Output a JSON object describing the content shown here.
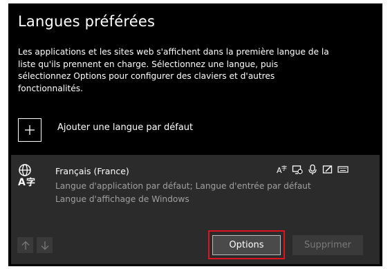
{
  "section": {
    "title": "Langues préférées",
    "description_lines": [
      "Les applications et les sites web s'affichent dans la première langue de la",
      "liste qu'ils prennent en charge. Sélectionnez une langue, puis",
      "sélectionnez Options pour configurer des claviers et d'autres",
      "fonctionnalités."
    ],
    "add_language_label": "Ajouter une langue par défaut"
  },
  "language": {
    "name": "Français (France)",
    "detail_lines": [
      "Langue d'application par défaut; Langue d'entrée par défaut",
      "Langue d'affichage de Windows"
    ],
    "feature_icons": [
      "text-to-speech-icon",
      "display-language-icon",
      "speech-recognition-icon",
      "handwriting-icon",
      "keyboard-icon"
    ]
  },
  "buttons": {
    "options": "Options",
    "remove": "Supprimer",
    "move_up_icon": "arrow-up-icon",
    "move_down_icon": "arrow-down-icon"
  },
  "colors": {
    "background": "#000000",
    "card": "#2b2b2b",
    "highlight": "#e0141e"
  }
}
